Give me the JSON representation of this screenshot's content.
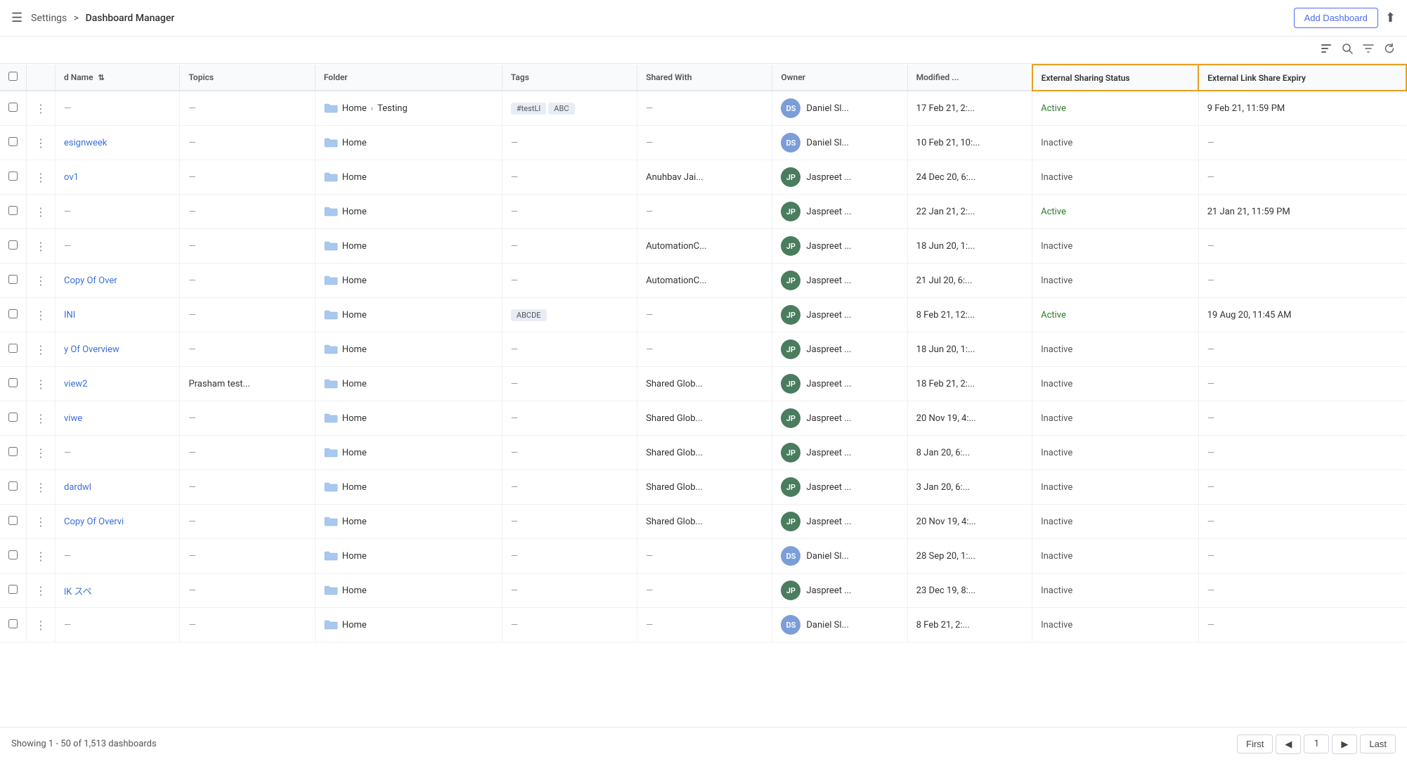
{
  "topbar": {
    "menu_icon": "☰",
    "breadcrumb_root": "Settings",
    "breadcrumb_sep": ">",
    "breadcrumb_current": "Dashboard Manager",
    "add_dashboard_label": "Add Dashboard",
    "export_icon": "⬆"
  },
  "toolbar": {
    "filter_layout_icon": "▤",
    "search_icon": "🔍",
    "filter_icon": "⊻",
    "refresh_icon": "↻"
  },
  "columns": {
    "check": "",
    "menu": "",
    "name": "d Name",
    "topics": "Topics",
    "folder": "Folder",
    "tags": "Tags",
    "shared_with": "Shared With",
    "owner": "Owner",
    "modified": "Modified ...",
    "ext_status": "External Sharing Status",
    "ext_expiry": "External Link Share Expiry"
  },
  "rows": [
    {
      "name": "",
      "name_link": false,
      "topics": "—",
      "folder": "Home > Testing",
      "folder_sub": "Testing",
      "has_sub": true,
      "tags": [
        "#testLI",
        "ABC"
      ],
      "shared_with": "—",
      "owner_name": "Daniel Sl...",
      "owner_color": "#7b9ed9",
      "owner_initials": "DS",
      "modified": "17 Feb 21, 2:...",
      "ext_status": "Active",
      "ext_expiry": "9 Feb 21, 11:59 PM"
    },
    {
      "name": "esignweek",
      "name_link": true,
      "topics": "—",
      "folder": "Home",
      "has_sub": false,
      "tags": [],
      "shared_with": "—",
      "owner_name": "Daniel Sl...",
      "owner_color": "#7b9ed9",
      "owner_initials": "DS",
      "modified": "10 Feb 21, 10:...",
      "ext_status": "Inactive",
      "ext_expiry": "—"
    },
    {
      "name": "ov1",
      "name_link": true,
      "topics": "—",
      "folder": "Home",
      "has_sub": false,
      "tags": [],
      "shared_with": "Anuhbav Jai...",
      "owner_name": "Jaspreet ...",
      "owner_color": "#4a7c5e",
      "owner_initials": "JP",
      "modified": "24 Dec 20, 6:...",
      "ext_status": "Inactive",
      "ext_expiry": "—"
    },
    {
      "name": "",
      "name_link": false,
      "topics": "—",
      "folder": "Home",
      "has_sub": false,
      "tags": [],
      "shared_with": "—",
      "owner_name": "Jaspreet ...",
      "owner_color": "#4a7c5e",
      "owner_initials": "JP",
      "modified": "22 Jan 21, 2:...",
      "ext_status": "Active",
      "ext_expiry": "21 Jan 21, 11:59 PM"
    },
    {
      "name": "",
      "name_link": false,
      "topics": "—",
      "folder": "Home",
      "has_sub": false,
      "tags": [],
      "shared_with": "AutomationC...",
      "owner_name": "Jaspreet ...",
      "owner_color": "#4a7c5e",
      "owner_initials": "JP",
      "modified": "18 Jun 20, 1:...",
      "ext_status": "Inactive",
      "ext_expiry": "—"
    },
    {
      "name": "Copy Of Over",
      "name_link": true,
      "topics": "—",
      "folder": "Home",
      "has_sub": false,
      "tags": [],
      "shared_with": "AutomationC...",
      "owner_name": "Jaspreet ...",
      "owner_color": "#4a7c5e",
      "owner_initials": "JP",
      "modified": "21 Jul 20, 6:...",
      "ext_status": "Inactive",
      "ext_expiry": "—"
    },
    {
      "name": "INI",
      "name_link": true,
      "topics": "—",
      "folder": "Home",
      "has_sub": false,
      "tags": [
        "ABCDE"
      ],
      "shared_with": "—",
      "owner_name": "Jaspreet ...",
      "owner_color": "#4a7c5e",
      "owner_initials": "JP",
      "modified": "8 Feb 21, 12:...",
      "ext_status": "Active",
      "ext_expiry": "19 Aug 20, 11:45 AM"
    },
    {
      "name": "y Of Overview",
      "name_link": true,
      "topics": "—",
      "folder": "Home",
      "has_sub": false,
      "tags": [],
      "shared_with": "—",
      "owner_name": "Jaspreet ...",
      "owner_color": "#4a7c5e",
      "owner_initials": "JP",
      "modified": "18 Jun 20, 1:...",
      "ext_status": "Inactive",
      "ext_expiry": "—"
    },
    {
      "name": "view2",
      "name_link": true,
      "topics": "Prasham test...",
      "folder": "Home",
      "has_sub": false,
      "tags": [],
      "shared_with": "Shared Glob...",
      "owner_name": "Jaspreet ...",
      "owner_color": "#4a7c5e",
      "owner_initials": "JP",
      "modified": "18 Feb 21, 2:...",
      "ext_status": "Inactive",
      "ext_expiry": "—"
    },
    {
      "name": "viwe",
      "name_link": true,
      "topics": "—",
      "folder": "Home",
      "has_sub": false,
      "tags": [],
      "shared_with": "Shared Glob...",
      "owner_name": "Jaspreet ...",
      "owner_color": "#4a7c5e",
      "owner_initials": "JP",
      "modified": "20 Nov 19, 4:...",
      "ext_status": "Inactive",
      "ext_expiry": "—"
    },
    {
      "name": "",
      "name_link": false,
      "topics": "—",
      "folder": "Home",
      "has_sub": false,
      "tags": [],
      "shared_with": "Shared Glob...",
      "owner_name": "Jaspreet ...",
      "owner_color": "#4a7c5e",
      "owner_initials": "JP",
      "modified": "8 Jan 20, 6:...",
      "ext_status": "Inactive",
      "ext_expiry": "—"
    },
    {
      "name": "dardwl",
      "name_link": true,
      "topics": "—",
      "folder": "Home",
      "has_sub": false,
      "tags": [],
      "shared_with": "Shared Glob...",
      "owner_name": "Jaspreet ...",
      "owner_color": "#4a7c5e",
      "owner_initials": "JP",
      "modified": "3 Jan 20, 6:...",
      "ext_status": "Inactive",
      "ext_expiry": "—"
    },
    {
      "name": "Copy Of Overvi",
      "name_link": true,
      "topics": "—",
      "folder": "Home",
      "has_sub": false,
      "tags": [],
      "shared_with": "Shared Glob...",
      "owner_name": "Jaspreet ...",
      "owner_color": "#4a7c5e",
      "owner_initials": "JP",
      "modified": "20 Nov 19, 4:...",
      "ext_status": "Inactive",
      "ext_expiry": "—"
    },
    {
      "name": "",
      "name_link": false,
      "topics": "—",
      "folder": "Home",
      "has_sub": false,
      "tags": [],
      "shared_with": "—",
      "owner_name": "Daniel Sl...",
      "owner_color": "#7b9ed9",
      "owner_initials": "DS",
      "modified": "28 Sep 20, 1:...",
      "ext_status": "Inactive",
      "ext_expiry": "—"
    },
    {
      "name": "lK スペ",
      "name_link": true,
      "topics": "—",
      "folder": "Home",
      "has_sub": false,
      "tags": [],
      "shared_with": "—",
      "owner_name": "Jaspreet ...",
      "owner_color": "#4a7c5e",
      "owner_initials": "JP",
      "modified": "23 Dec 19, 8:...",
      "ext_status": "Inactive",
      "ext_expiry": "—"
    },
    {
      "name": "",
      "name_link": false,
      "topics": "—",
      "folder": "Home",
      "has_sub": false,
      "tags": [],
      "shared_with": "—",
      "owner_name": "Daniel Sl...",
      "owner_color": "#7b9ed9",
      "owner_initials": "DS",
      "modified": "8 Feb 21, 2:...",
      "ext_status": "Inactive",
      "ext_expiry": "—"
    }
  ],
  "footer": {
    "showing_text": "Showing 1 - 50 of 1,513 dashboards",
    "first_label": "First",
    "last_label": "Last",
    "prev_icon": "◀",
    "next_icon": "▶",
    "current_page": "1"
  }
}
